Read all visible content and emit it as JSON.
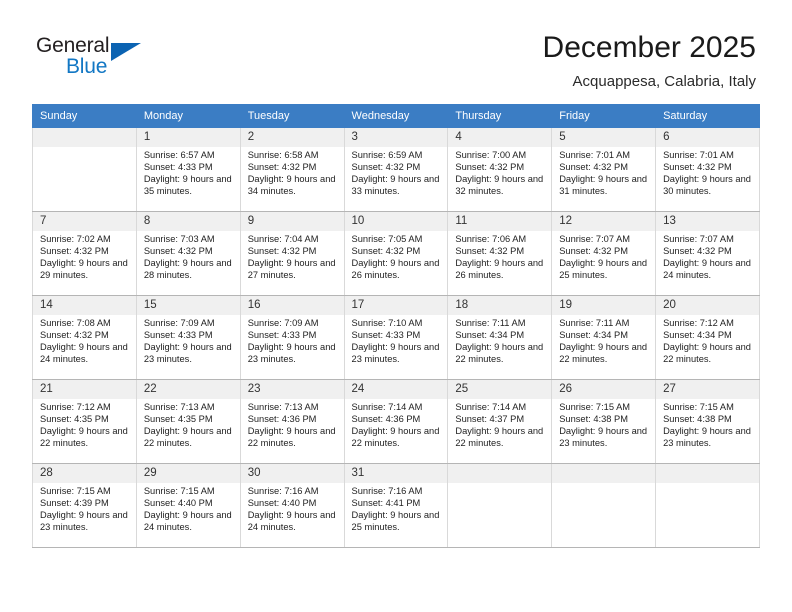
{
  "brand": {
    "word_one": "General",
    "word_two": "Blue",
    "logo_icon": "triangle-logo-icon"
  },
  "header": {
    "title": "December 2025",
    "subtitle": "Acquappesa, Calabria, Italy"
  },
  "colors": {
    "header_row": "#3b7dc4",
    "brand_blue": "#1277c4",
    "daynum_bg": "#f0f0f0",
    "grid_line": "#d9d9d9"
  },
  "calendar": {
    "weekday_headers": [
      "Sunday",
      "Monday",
      "Tuesday",
      "Wednesday",
      "Thursday",
      "Friday",
      "Saturday"
    ],
    "weeks": [
      [
        {
          "day": "",
          "sunrise": "",
          "sunset": "",
          "daylight": "",
          "empty": true
        },
        {
          "day": "1",
          "sunrise": "Sunrise: 6:57 AM",
          "sunset": "Sunset: 4:33 PM",
          "daylight": "Daylight: 9 hours and 35 minutes."
        },
        {
          "day": "2",
          "sunrise": "Sunrise: 6:58 AM",
          "sunset": "Sunset: 4:32 PM",
          "daylight": "Daylight: 9 hours and 34 minutes."
        },
        {
          "day": "3",
          "sunrise": "Sunrise: 6:59 AM",
          "sunset": "Sunset: 4:32 PM",
          "daylight": "Daylight: 9 hours and 33 minutes."
        },
        {
          "day": "4",
          "sunrise": "Sunrise: 7:00 AM",
          "sunset": "Sunset: 4:32 PM",
          "daylight": "Daylight: 9 hours and 32 minutes."
        },
        {
          "day": "5",
          "sunrise": "Sunrise: 7:01 AM",
          "sunset": "Sunset: 4:32 PM",
          "daylight": "Daylight: 9 hours and 31 minutes."
        },
        {
          "day": "6",
          "sunrise": "Sunrise: 7:01 AM",
          "sunset": "Sunset: 4:32 PM",
          "daylight": "Daylight: 9 hours and 30 minutes."
        }
      ],
      [
        {
          "day": "7",
          "sunrise": "Sunrise: 7:02 AM",
          "sunset": "Sunset: 4:32 PM",
          "daylight": "Daylight: 9 hours and 29 minutes."
        },
        {
          "day": "8",
          "sunrise": "Sunrise: 7:03 AM",
          "sunset": "Sunset: 4:32 PM",
          "daylight": "Daylight: 9 hours and 28 minutes."
        },
        {
          "day": "9",
          "sunrise": "Sunrise: 7:04 AM",
          "sunset": "Sunset: 4:32 PM",
          "daylight": "Daylight: 9 hours and 27 minutes."
        },
        {
          "day": "10",
          "sunrise": "Sunrise: 7:05 AM",
          "sunset": "Sunset: 4:32 PM",
          "daylight": "Daylight: 9 hours and 26 minutes."
        },
        {
          "day": "11",
          "sunrise": "Sunrise: 7:06 AM",
          "sunset": "Sunset: 4:32 PM",
          "daylight": "Daylight: 9 hours and 26 minutes."
        },
        {
          "day": "12",
          "sunrise": "Sunrise: 7:07 AM",
          "sunset": "Sunset: 4:32 PM",
          "daylight": "Daylight: 9 hours and 25 minutes."
        },
        {
          "day": "13",
          "sunrise": "Sunrise: 7:07 AM",
          "sunset": "Sunset: 4:32 PM",
          "daylight": "Daylight: 9 hours and 24 minutes."
        }
      ],
      [
        {
          "day": "14",
          "sunrise": "Sunrise: 7:08 AM",
          "sunset": "Sunset: 4:32 PM",
          "daylight": "Daylight: 9 hours and 24 minutes."
        },
        {
          "day": "15",
          "sunrise": "Sunrise: 7:09 AM",
          "sunset": "Sunset: 4:33 PM",
          "daylight": "Daylight: 9 hours and 23 minutes."
        },
        {
          "day": "16",
          "sunrise": "Sunrise: 7:09 AM",
          "sunset": "Sunset: 4:33 PM",
          "daylight": "Daylight: 9 hours and 23 minutes."
        },
        {
          "day": "17",
          "sunrise": "Sunrise: 7:10 AM",
          "sunset": "Sunset: 4:33 PM",
          "daylight": "Daylight: 9 hours and 23 minutes."
        },
        {
          "day": "18",
          "sunrise": "Sunrise: 7:11 AM",
          "sunset": "Sunset: 4:34 PM",
          "daylight": "Daylight: 9 hours and 22 minutes."
        },
        {
          "day": "19",
          "sunrise": "Sunrise: 7:11 AM",
          "sunset": "Sunset: 4:34 PM",
          "daylight": "Daylight: 9 hours and 22 minutes."
        },
        {
          "day": "20",
          "sunrise": "Sunrise: 7:12 AM",
          "sunset": "Sunset: 4:34 PM",
          "daylight": "Daylight: 9 hours and 22 minutes."
        }
      ],
      [
        {
          "day": "21",
          "sunrise": "Sunrise: 7:12 AM",
          "sunset": "Sunset: 4:35 PM",
          "daylight": "Daylight: 9 hours and 22 minutes."
        },
        {
          "day": "22",
          "sunrise": "Sunrise: 7:13 AM",
          "sunset": "Sunset: 4:35 PM",
          "daylight": "Daylight: 9 hours and 22 minutes."
        },
        {
          "day": "23",
          "sunrise": "Sunrise: 7:13 AM",
          "sunset": "Sunset: 4:36 PM",
          "daylight": "Daylight: 9 hours and 22 minutes."
        },
        {
          "day": "24",
          "sunrise": "Sunrise: 7:14 AM",
          "sunset": "Sunset: 4:36 PM",
          "daylight": "Daylight: 9 hours and 22 minutes."
        },
        {
          "day": "25",
          "sunrise": "Sunrise: 7:14 AM",
          "sunset": "Sunset: 4:37 PM",
          "daylight": "Daylight: 9 hours and 22 minutes."
        },
        {
          "day": "26",
          "sunrise": "Sunrise: 7:15 AM",
          "sunset": "Sunset: 4:38 PM",
          "daylight": "Daylight: 9 hours and 23 minutes."
        },
        {
          "day": "27",
          "sunrise": "Sunrise: 7:15 AM",
          "sunset": "Sunset: 4:38 PM",
          "daylight": "Daylight: 9 hours and 23 minutes."
        }
      ],
      [
        {
          "day": "28",
          "sunrise": "Sunrise: 7:15 AM",
          "sunset": "Sunset: 4:39 PM",
          "daylight": "Daylight: 9 hours and 23 minutes."
        },
        {
          "day": "29",
          "sunrise": "Sunrise: 7:15 AM",
          "sunset": "Sunset: 4:40 PM",
          "daylight": "Daylight: 9 hours and 24 minutes."
        },
        {
          "day": "30",
          "sunrise": "Sunrise: 7:16 AM",
          "sunset": "Sunset: 4:40 PM",
          "daylight": "Daylight: 9 hours and 24 minutes."
        },
        {
          "day": "31",
          "sunrise": "Sunrise: 7:16 AM",
          "sunset": "Sunset: 4:41 PM",
          "daylight": "Daylight: 9 hours and 25 minutes."
        },
        {
          "day": "",
          "sunrise": "",
          "sunset": "",
          "daylight": "",
          "empty": true
        },
        {
          "day": "",
          "sunrise": "",
          "sunset": "",
          "daylight": "",
          "empty": true
        },
        {
          "day": "",
          "sunrise": "",
          "sunset": "",
          "daylight": "",
          "empty": true
        }
      ]
    ]
  }
}
